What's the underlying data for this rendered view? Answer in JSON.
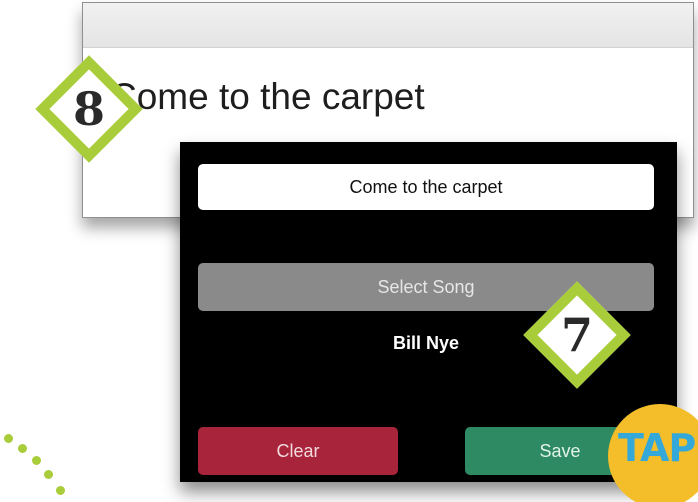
{
  "background_card": {
    "title": "Come to the carpet"
  },
  "popup": {
    "title_field_value": "Come to the carpet",
    "select_song_label": "Select Song",
    "selected_song": "Bill Nye",
    "clear_label": "Clear",
    "save_label": "Save"
  },
  "markers": {
    "step_8": "8",
    "step_7": "7",
    "tap_label": "TAP"
  },
  "colors": {
    "marker_green": "#a8cc3a",
    "clear_red": "#a8243a",
    "save_green": "#2e8a62",
    "select_gray": "#8a8a8a",
    "tap_yellow": "#f4bd2a",
    "tap_blue": "#34a8d8"
  }
}
